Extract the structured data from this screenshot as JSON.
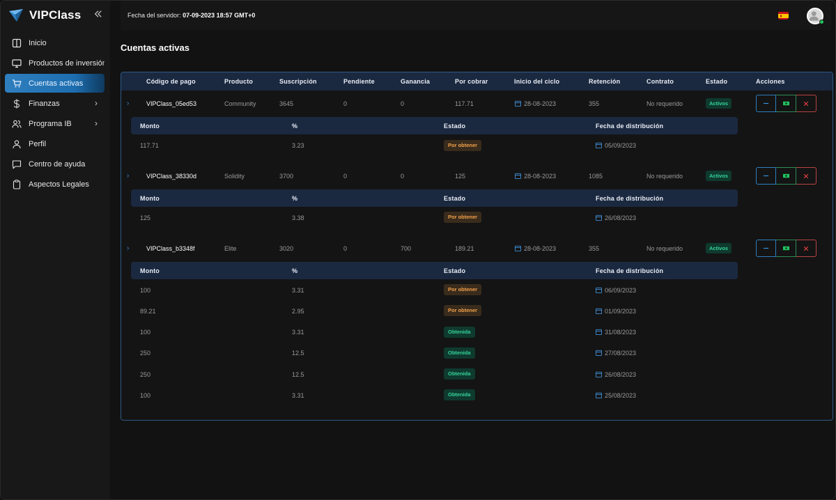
{
  "brand": {
    "name": "VIPClass"
  },
  "sidebar": {
    "items": [
      {
        "label": "Inicio",
        "icon": "book-icon"
      },
      {
        "label": "Productos de inversión",
        "icon": "monitor-icon"
      },
      {
        "label": "Cuentas activas",
        "icon": "cart-icon",
        "active": true
      },
      {
        "label": "Finanzas",
        "icon": "dollar-icon",
        "submenu": true
      },
      {
        "label": "Programa IB",
        "icon": "users-icon",
        "submenu": true
      },
      {
        "label": "Perfil",
        "icon": "user-icon"
      },
      {
        "label": "Centro de ayuda",
        "icon": "chat-icon"
      },
      {
        "label": "Aspectos Legales",
        "icon": "clipboard-icon"
      }
    ]
  },
  "header": {
    "server_time_label": "Fecha del servidor:",
    "server_time_value": "07-09-2023 18:57 GMT+0",
    "language": "es"
  },
  "page": {
    "title": "Cuentas activas"
  },
  "table": {
    "columns": [
      "Código de pago",
      "Producto",
      "Suscripción",
      "Pendiente",
      "Ganancia",
      "Por cobrar",
      "Inicio del ciclo",
      "Retención",
      "Contrato",
      "Estado",
      "Acciones"
    ],
    "sub_columns": [
      "Monto",
      "%",
      "Estado",
      "Fecha de distribución"
    ],
    "rows": [
      {
        "code": "VIPClass_05ed53",
        "product": "Community",
        "subscription": "3645",
        "pending": "0",
        "profit": "0",
        "receivable": "117.71",
        "cycle_start": "28-08-2023",
        "retention": "355",
        "contract": "No requerido",
        "status": "Activos",
        "details": [
          {
            "amount": "117.71",
            "percent": "3.23",
            "status": "Por obtener",
            "date": "05/09/2023"
          }
        ]
      },
      {
        "code": "VIPClass_38330d",
        "product": "Solidity",
        "subscription": "3700",
        "pending": "0",
        "profit": "0",
        "receivable": "125",
        "cycle_start": "28-08-2023",
        "retention": "1085",
        "contract": "No requerido",
        "status": "Activos",
        "details": [
          {
            "amount": "125",
            "percent": "3.38",
            "status": "Por obtener",
            "date": "26/08/2023"
          }
        ]
      },
      {
        "code": "VIPClass_b3348f",
        "product": "Elite",
        "subscription": "3020",
        "pending": "0",
        "profit": "700",
        "receivable": "189.21",
        "cycle_start": "28-08-2023",
        "retention": "355",
        "contract": "No requerido",
        "status": "Activos",
        "details": [
          {
            "amount": "100",
            "percent": "3.31",
            "status": "Por obtener",
            "date": "06/09/2023"
          },
          {
            "amount": "89.21",
            "percent": "2.95",
            "status": "Por obtener",
            "date": "01/09/2023"
          },
          {
            "amount": "100",
            "percent": "3.31",
            "status": "Obtenida",
            "date": "31/08/2023"
          },
          {
            "amount": "250",
            "percent": "12.5",
            "status": "Obtenida",
            "date": "27/08/2023"
          },
          {
            "amount": "250",
            "percent": "12.5",
            "status": "Obtenida",
            "date": "26/08/2023"
          },
          {
            "amount": "100",
            "percent": "3.31",
            "status": "Obtenida",
            "date": "25/08/2023"
          }
        ]
      }
    ]
  },
  "colors": {
    "accent": "#2f7fbf",
    "success": "#34d399",
    "warning": "#f0a04b",
    "danger": "#ef4444",
    "background": "#121212"
  }
}
